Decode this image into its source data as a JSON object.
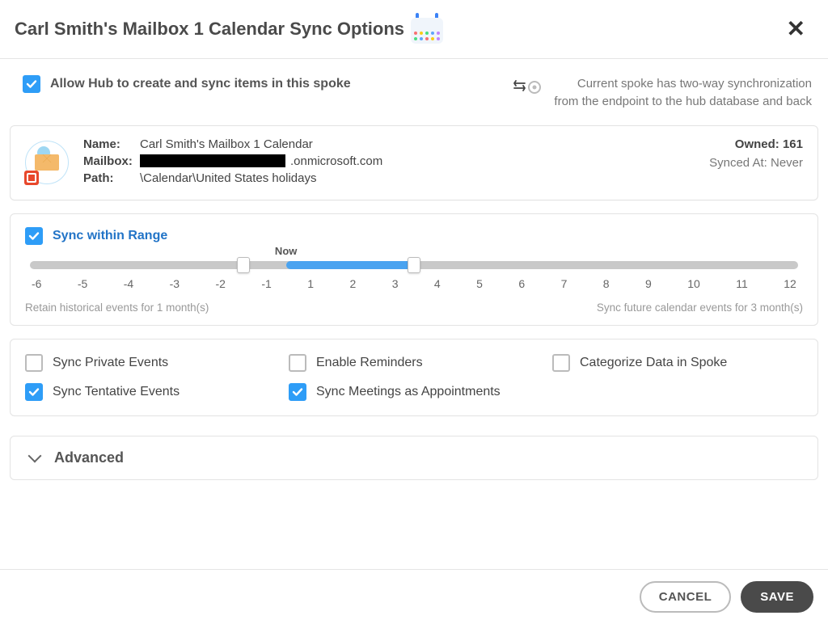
{
  "header": {
    "title": "Carl Smith's Mailbox 1 Calendar Sync Options"
  },
  "allow_hub": {
    "checked": true,
    "label": "Allow Hub to create and sync items in this spoke"
  },
  "sync_direction": {
    "line1": "Current spoke has two-way synchronization",
    "line2": "from the endpoint to the hub database and back"
  },
  "details": {
    "name_label": "Name:",
    "name_value": "Carl Smith's Mailbox 1 Calendar",
    "mailbox_label": "Mailbox:",
    "mailbox_suffix": ".onmicrosoft.com",
    "path_label": "Path:",
    "path_value": "\\Calendar\\United States holidays",
    "owned_label": "Owned:",
    "owned_value": "161",
    "synced_at_label": "Synced At:",
    "synced_at_value": "Never"
  },
  "range": {
    "checked": true,
    "label": "Sync within Range",
    "now_label": "Now",
    "min": -6,
    "max": 12,
    "low_handle": -1,
    "high_handle": 3,
    "ticks": [
      "-6",
      "-5",
      "-4",
      "-3",
      "-2",
      "-1",
      "1",
      "2",
      "3",
      "4",
      "5",
      "6",
      "7",
      "8",
      "9",
      "10",
      "11",
      "12"
    ],
    "retain_prefix": "Retain historical events for",
    "retain_months": "1",
    "retain_suffix": "month(s)",
    "future_prefix": "Sync future calendar events for",
    "future_months": "3",
    "future_suffix": "month(s)"
  },
  "options": {
    "sync_private": {
      "checked": false,
      "label": "Sync Private Events"
    },
    "enable_reminders": {
      "checked": false,
      "label": "Enable Reminders"
    },
    "categorize": {
      "checked": false,
      "label": "Categorize Data in Spoke"
    },
    "sync_tentative": {
      "checked": true,
      "label": "Sync Tentative Events"
    },
    "sync_meetings": {
      "checked": true,
      "label": "Sync Meetings as Appointments"
    }
  },
  "advanced": {
    "label": "Advanced"
  },
  "footer": {
    "cancel": "CANCEL",
    "save": "SAVE"
  }
}
